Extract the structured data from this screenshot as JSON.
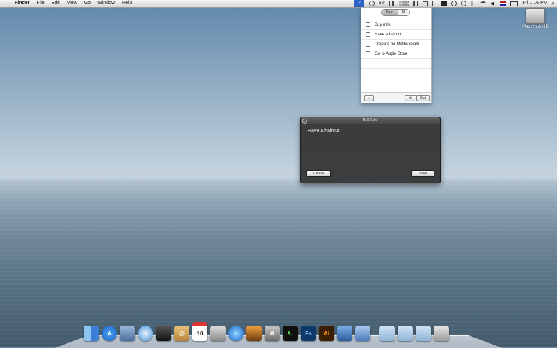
{
  "menubar": {
    "apple": "",
    "app_name": "Finder",
    "items": [
      "File",
      "Edit",
      "View",
      "Go",
      "Window",
      "Help"
    ],
    "status": {
      "temperature": "68°",
      "network_top": "0.0KB/s",
      "network_bottom": "0.0KB/s",
      "clock": "Fri 1:16 PM"
    }
  },
  "desktop": {
    "hd_label": "Macintosh HD"
  },
  "todo_popover": {
    "tabs": [
      "Todo",
      "All"
    ],
    "active_tab": "Todo",
    "items": [
      "Buy milk",
      "Have a haircut",
      "Prepare for Maths exam",
      "Go to Apple Store"
    ],
    "footer": {
      "left_button": "↑",
      "gear_button": "⚙",
      "quit_button": "Quit"
    }
  },
  "edit_window": {
    "title": "Edit Todo",
    "text": "Have a haircut",
    "cancel_label": "Cancel",
    "save_label": "Save"
  },
  "dock": {
    "calendar_day": "10",
    "photoshop": "Ps",
    "illustrator": "Ai",
    "terminal": "$_"
  }
}
